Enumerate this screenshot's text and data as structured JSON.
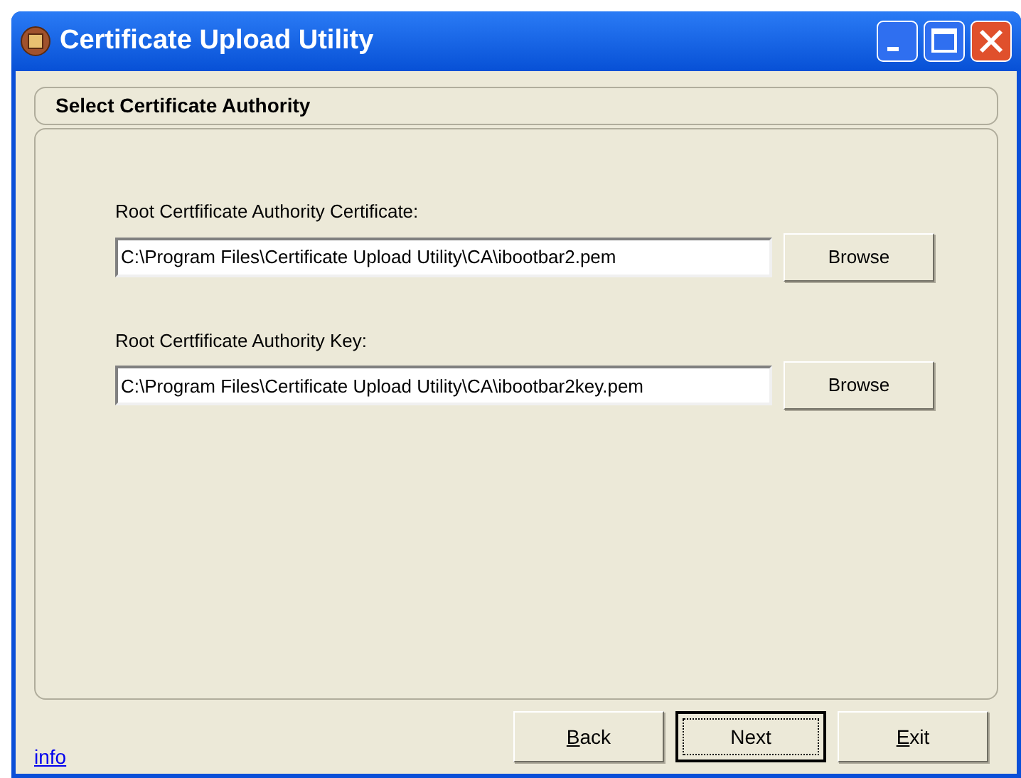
{
  "window": {
    "title": "Certificate Upload Utility"
  },
  "header": {
    "title": "Select Certificate Authority"
  },
  "fields": [
    {
      "label": "Root Certfificate Authority Certificate:",
      "value": "C:\\Program Files\\Certificate Upload Utility\\CA\\ibootbar2.pem",
      "button": "Browse"
    },
    {
      "label": "Root Certfificate Authority Key:",
      "value": "C:\\Program Files\\Certificate Upload Utility\\CA\\ibootbar2key.pem",
      "button": "Browse"
    }
  ],
  "link": "info",
  "buttons": [
    {
      "label": "Back",
      "mnemonic": true,
      "focused": false
    },
    {
      "label": "Next",
      "mnemonic": false,
      "focused": true
    },
    {
      "label": "Exit",
      "mnemonic": true,
      "focused": false
    }
  ]
}
